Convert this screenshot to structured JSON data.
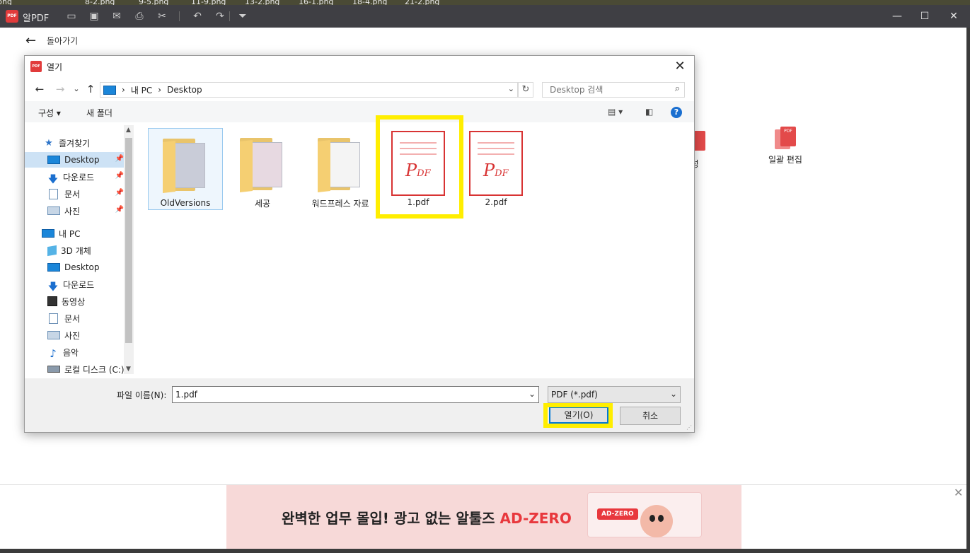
{
  "top_strip": [
    "png",
    "8-2.png",
    "9-5.png",
    "11-9.png",
    "13-2.png",
    "16-1.png",
    "18-4.png",
    "21-2.png"
  ],
  "app": {
    "logo_text": "PDF",
    "name": "알PDF"
  },
  "main": {
    "back_label": "돌아가기",
    "tools": [
      {
        "label": "성"
      },
      {
        "label": "일괄 편집",
        "icon_text": "PDF"
      }
    ]
  },
  "ad": {
    "text": "완벽한 업무 몰입! 광고 없는 알툴즈 ",
    "brand": "AD-ZERO",
    "badge": "AD-ZERO",
    "close": "✕"
  },
  "dialog": {
    "icon_text": "PDF",
    "title": "열기",
    "close": "✕",
    "nav": {
      "back": "←",
      "forward": "→",
      "recent": "⌄",
      "up": "↑"
    },
    "address": {
      "crumb1": "내 PC",
      "sep": "›",
      "crumb2": "Desktop"
    },
    "search_placeholder": "Desktop 검색",
    "commands": {
      "organize": "구성 ▾",
      "new_folder": "새 폴더",
      "help": "?"
    },
    "sidebar": {
      "quick_access": "즐겨찾기",
      "items_quick": [
        "Desktop",
        "다운로드",
        "문서",
        "사진"
      ],
      "this_pc": "내 PC",
      "items_pc": [
        "3D 개체",
        "Desktop",
        "다운로드",
        "동영상",
        "문서",
        "사진",
        "음악",
        "로컬 디스크 (C:)"
      ]
    },
    "files": [
      {
        "name": "OldVersions",
        "type": "folder"
      },
      {
        "name": "세공",
        "type": "folder"
      },
      {
        "name": "워드프레스 자료",
        "type": "folder"
      },
      {
        "name": "1.pdf",
        "type": "pdf"
      },
      {
        "name": "2.pdf",
        "type": "pdf"
      }
    ],
    "filename_label": "파일 이름(N):",
    "filename_value": "1.pdf",
    "filetype": "PDF (*.pdf)",
    "open_button": "열기(O)",
    "cancel_button": "취소"
  },
  "colors": {
    "highlight": "#ffee00",
    "pdf_red": "#d83333",
    "brand_red": "#e8383d"
  }
}
